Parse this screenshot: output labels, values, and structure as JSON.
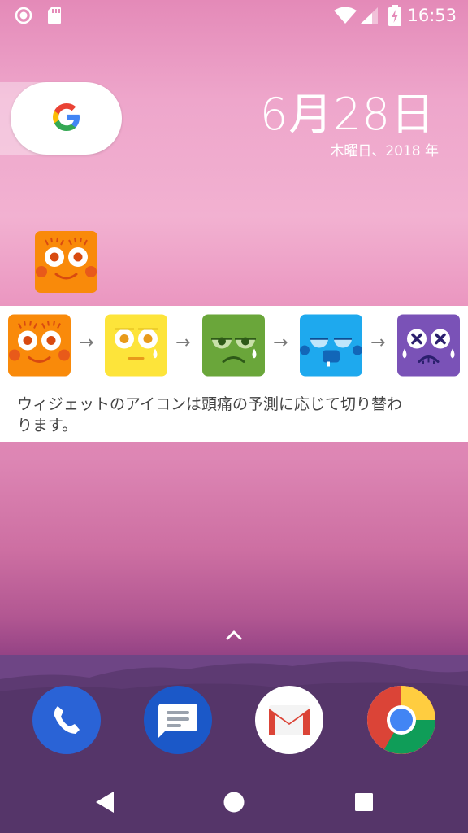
{
  "status_bar": {
    "time": "16:53",
    "icons": [
      "record-icon",
      "sd-card-icon",
      "wifi-icon",
      "signal-icon",
      "battery-charging-icon"
    ]
  },
  "search_widget": {
    "icon": "google-g-icon"
  },
  "clock_widget": {
    "date": "6月28日",
    "day_year": "木曜日、2018 年"
  },
  "home_app": {
    "icon": "happy-face-orange-icon"
  },
  "info_card": {
    "faces": [
      {
        "name": "happy",
        "color": "#f98a0a"
      },
      {
        "name": "meh",
        "color": "#fde43a"
      },
      {
        "name": "sad",
        "color": "#6aa63a"
      },
      {
        "name": "cold",
        "color": "#1ea9ee"
      },
      {
        "name": "dizzy",
        "color": "#7a52b7"
      }
    ],
    "arrow": "→",
    "text": "ウィジェットのアイコンは頭痛の予測に応じて切り替わります。"
  },
  "dock": {
    "apps": [
      {
        "name": "phone",
        "color": "#2a63d6"
      },
      {
        "name": "messages",
        "color": "#1b58c8"
      },
      {
        "name": "gmail",
        "color": "#ffffff"
      },
      {
        "name": "chrome",
        "color": "#ffffff"
      }
    ]
  },
  "nav": {
    "buttons": [
      "back",
      "home",
      "recents"
    ]
  }
}
